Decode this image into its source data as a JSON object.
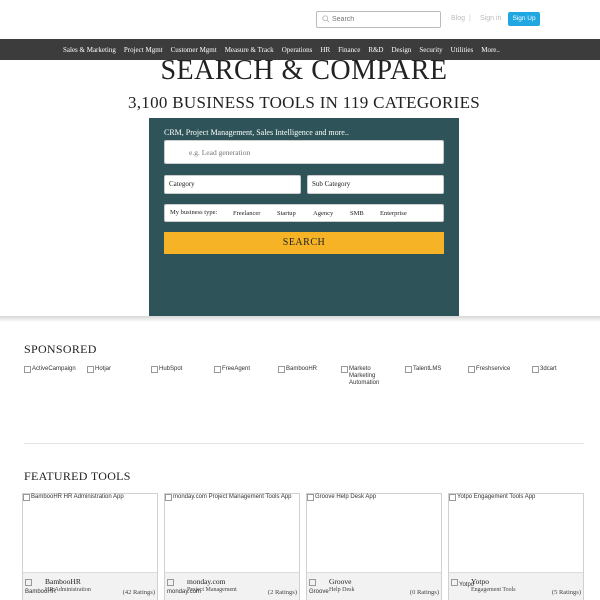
{
  "topbar": {
    "search_placeholder": "Search",
    "link_1": "Blog",
    "link_2": "Sign in",
    "separator": "|",
    "signup_label": "Sign Up"
  },
  "nav": {
    "items": [
      "Sales & Marketing",
      "Project Mgmt",
      "Customer Mgmt",
      "Measure & Track",
      "Operations",
      "HR",
      "Finance",
      "R&D",
      "Design",
      "Security",
      "Utilities",
      "More.."
    ]
  },
  "hero": {
    "title": "SEARCH & COMPARE",
    "subtitle": "3,100 BUSINESS TOOLS IN 119 CATEGORIES"
  },
  "panel": {
    "caption": "CRM, Project Management, Sales Intelligence and more..",
    "search_placeholder": "e.g. Lead generation",
    "category_label": "Category",
    "subcategory_label": "Sub Category",
    "business_type_label": "My business type:",
    "business_types": [
      "Freelancer",
      "Startup",
      "Agency",
      "SMB",
      "Enterprise"
    ],
    "search_button": "SEARCH"
  },
  "sponsored": {
    "title": "SPONSORED",
    "items": [
      "ActiveCampaign",
      "Hotjar",
      "HubSpot",
      "FreeAgent",
      "BambooHR",
      "Marketo Marketing Automation",
      "TalentLMS",
      "Freshservice",
      "3dcart"
    ]
  },
  "featured": {
    "title": "FEATURED TOOLS",
    "cards": [
      {
        "image_alt": "BambooHR HR Administration App",
        "logo_alt": "BambooHR",
        "name": "BambooHR",
        "category": "HR Administration",
        "ratings": "(42 Ratings)"
      },
      {
        "image_alt": "monday.com Project Management Tools App",
        "logo_alt": "monday.com",
        "name": "monday.com",
        "category": "Project Management",
        "ratings": "(2 Ratings)"
      },
      {
        "image_alt": "Groove Help Desk App",
        "logo_alt": "Groove",
        "name": "Groove",
        "category": "Help Desk",
        "ratings": "(0 Ratings)"
      },
      {
        "image_alt": "Yotpo Engagement Tools App",
        "logo_alt": "Yotpo",
        "name": "Yotpo",
        "category": "Engagement Tools",
        "ratings": "(5 Ratings)"
      }
    ]
  }
}
